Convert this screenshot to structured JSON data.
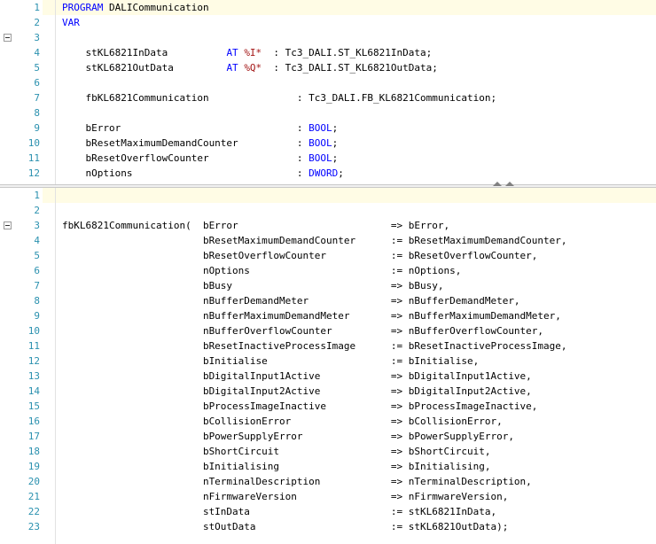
{
  "declaration": {
    "lines": [
      {
        "n": "1",
        "parts": [
          [
            "kw",
            "PROGRAM"
          ],
          [
            "tx",
            " DALICommunication"
          ]
        ]
      },
      {
        "n": "2",
        "parts": [
          [
            "kw",
            "VAR"
          ]
        ]
      },
      {
        "n": "3",
        "parts": []
      },
      {
        "n": "4",
        "parts": [
          [
            "tx",
            "    stKL6821InData          "
          ],
          [
            "at",
            "AT"
          ],
          [
            "tx",
            " "
          ],
          [
            "addr",
            "%I*"
          ],
          [
            "tx",
            "  : Tc3_DALI.ST_KL6821InData;"
          ]
        ]
      },
      {
        "n": "5",
        "parts": [
          [
            "tx",
            "    stKL6821OutData         "
          ],
          [
            "at",
            "AT"
          ],
          [
            "tx",
            " "
          ],
          [
            "addr",
            "%Q*"
          ],
          [
            "tx",
            "  : Tc3_DALI.ST_KL6821OutData;"
          ]
        ]
      },
      {
        "n": "6",
        "parts": []
      },
      {
        "n": "7",
        "parts": [
          [
            "tx",
            "    fbKL6821Communication               : Tc3_DALI.FB_KL6821Communication;"
          ]
        ]
      },
      {
        "n": "8",
        "parts": []
      },
      {
        "n": "9",
        "parts": [
          [
            "tx",
            "    bError                              : "
          ],
          [
            "ty",
            "BOOL"
          ],
          [
            "tx",
            ";"
          ]
        ]
      },
      {
        "n": "10",
        "parts": [
          [
            "tx",
            "    bResetMaximumDemandCounter          : "
          ],
          [
            "ty",
            "BOOL"
          ],
          [
            "tx",
            ";"
          ]
        ]
      },
      {
        "n": "11",
        "parts": [
          [
            "tx",
            "    bResetOverflowCounter               : "
          ],
          [
            "ty",
            "BOOL"
          ],
          [
            "tx",
            ";"
          ]
        ]
      },
      {
        "n": "12",
        "parts": [
          [
            "tx",
            "    nOptions                            : "
          ],
          [
            "ty",
            "DWORD"
          ],
          [
            "tx",
            ";"
          ]
        ]
      }
    ]
  },
  "implementation": {
    "lines": [
      {
        "n": "1",
        "parts": []
      },
      {
        "n": "2",
        "parts": []
      },
      {
        "n": "3",
        "parts": [
          [
            "tx",
            "fbKL6821Communication(  bError                          => bError,"
          ]
        ]
      },
      {
        "n": "4",
        "parts": [
          [
            "tx",
            "                        bResetMaximumDemandCounter      := bResetMaximumDemandCounter,"
          ]
        ]
      },
      {
        "n": "5",
        "parts": [
          [
            "tx",
            "                        bResetOverflowCounter           := bResetOverflowCounter,"
          ]
        ]
      },
      {
        "n": "6",
        "parts": [
          [
            "tx",
            "                        nOptions                        := nOptions,"
          ]
        ]
      },
      {
        "n": "7",
        "parts": [
          [
            "tx",
            "                        bBusy                           => bBusy,"
          ]
        ]
      },
      {
        "n": "8",
        "parts": [
          [
            "tx",
            "                        nBufferDemandMeter              => nBufferDemandMeter,"
          ]
        ]
      },
      {
        "n": "9",
        "parts": [
          [
            "tx",
            "                        nBufferMaximumDemandMeter       => nBufferMaximumDemandMeter,"
          ]
        ]
      },
      {
        "n": "10",
        "parts": [
          [
            "tx",
            "                        nBufferOverflowCounter          => nBufferOverflowCounter,"
          ]
        ]
      },
      {
        "n": "11",
        "parts": [
          [
            "tx",
            "                        bResetInactiveProcessImage      := bResetInactiveProcessImage,"
          ]
        ]
      },
      {
        "n": "12",
        "parts": [
          [
            "tx",
            "                        bInitialise                     := bInitialise,"
          ]
        ]
      },
      {
        "n": "13",
        "parts": [
          [
            "tx",
            "                        bDigitalInput1Active            => bDigitalInput1Active,"
          ]
        ]
      },
      {
        "n": "14",
        "parts": [
          [
            "tx",
            "                        bDigitalInput2Active            => bDigitalInput2Active,"
          ]
        ]
      },
      {
        "n": "15",
        "parts": [
          [
            "tx",
            "                        bProcessImageInactive           => bProcessImageInactive,"
          ]
        ]
      },
      {
        "n": "16",
        "parts": [
          [
            "tx",
            "                        bCollisionError                 => bCollisionError,"
          ]
        ]
      },
      {
        "n": "17",
        "parts": [
          [
            "tx",
            "                        bPowerSupplyError               => bPowerSupplyError,"
          ]
        ]
      },
      {
        "n": "18",
        "parts": [
          [
            "tx",
            "                        bShortCircuit                   => bShortCircuit,"
          ]
        ]
      },
      {
        "n": "19",
        "parts": [
          [
            "tx",
            "                        bInitialising                   => bInitialising,"
          ]
        ]
      },
      {
        "n": "20",
        "parts": [
          [
            "tx",
            "                        nTerminalDescription            => nTerminalDescription,"
          ]
        ]
      },
      {
        "n": "21",
        "parts": [
          [
            "tx",
            "                        nFirmwareVersion                => nFirmwareVersion,"
          ]
        ]
      },
      {
        "n": "22",
        "parts": [
          [
            "tx",
            "                        stInData                        := stKL6821InData,"
          ]
        ]
      },
      {
        "n": "23",
        "parts": [
          [
            "tx",
            "                        stOutData                       := stKL6821OutData);"
          ]
        ]
      }
    ]
  },
  "colors": {
    "keyword": "#0000ff",
    "address": "#a31515",
    "line_number": "#2b91af"
  },
  "icons": {
    "fold": "collapse-minus-icon",
    "splitter_up": "chevron-up-icon",
    "splitter_down": "chevron-down-icon"
  }
}
